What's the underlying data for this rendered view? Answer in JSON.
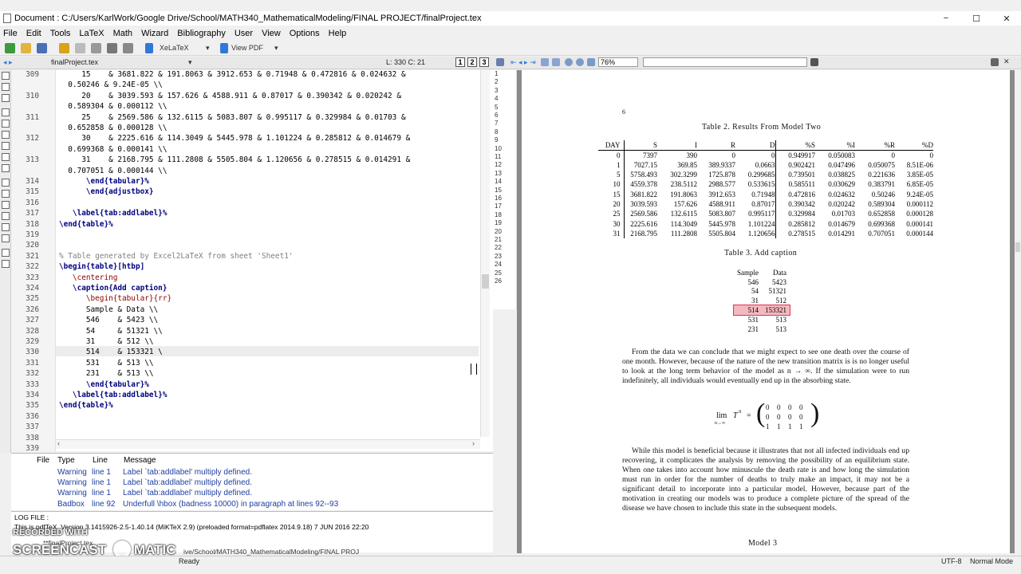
{
  "window": {
    "title": "Document : C:/Users/KarlWork/Google Drive/School/MATH340_MathematicalModeling/FINAL PROJECT/finalProject.tex",
    "minimize": "−",
    "maximize": "☐",
    "close": "✕"
  },
  "menu": [
    "File",
    "Edit",
    "Tools",
    "LaTeX",
    "Math",
    "Wizard",
    "Bibliography",
    "User",
    "View",
    "Options",
    "Help"
  ],
  "toolbar": {
    "compile": "XeLaTeX",
    "view": "View PDF"
  },
  "editor_tab": {
    "filename": "finalProject.tex",
    "position": "L: 330 C: 21",
    "views": [
      "1",
      "2",
      "3"
    ]
  },
  "code_lines": [
    {
      "n": "309",
      "t": "     15    & 3681.822 & 191.8063 & 3912.653 & 0.71948 & 0.472816 & 0.024632 &",
      "cls": ""
    },
    {
      "n": "",
      "t": "  0.50246 & 9.24E-05 \\\\",
      "cls": ""
    },
    {
      "n": "310",
      "t": "     20    & 3039.593 & 157.626 & 4588.911 & 0.87017 & 0.390342 & 0.020242 &",
      "cls": ""
    },
    {
      "n": "",
      "t": "  0.589304 & 0.000112 \\\\",
      "cls": ""
    },
    {
      "n": "311",
      "t": "     25    & 2569.586 & 132.6115 & 5083.807 & 0.995117 & 0.329984 & 0.01703 &",
      "cls": ""
    },
    {
      "n": "",
      "t": "  0.652858 & 0.000128 \\\\",
      "cls": ""
    },
    {
      "n": "312",
      "t": "     30    & 2225.616 & 114.3049 & 5445.978 & 1.101224 & 0.285812 & 0.014679 &",
      "cls": ""
    },
    {
      "n": "",
      "t": "  0.699368 & 0.000141 \\\\",
      "cls": ""
    },
    {
      "n": "313",
      "t": "     31    & 2168.795 & 111.2808 & 5505.804 & 1.120656 & 0.278515 & 0.014291 &",
      "cls": ""
    },
    {
      "n": "",
      "t": "  0.707051 & 0.000144 \\\\",
      "cls": ""
    },
    {
      "n": "314",
      "t": "      \\end{tabular}%",
      "cls": "kw"
    },
    {
      "n": "315",
      "t": "      \\end{adjustbox}",
      "cls": "kw"
    },
    {
      "n": "316",
      "t": "",
      "cls": ""
    },
    {
      "n": "317",
      "t": "   \\label{tab:addlabel}%",
      "cls": "kw"
    },
    {
      "n": "318",
      "t": "\\end{table}%",
      "cls": "kw"
    },
    {
      "n": "319",
      "t": "",
      "cls": ""
    },
    {
      "n": "320",
      "t": "",
      "cls": ""
    },
    {
      "n": "321",
      "t": "% Table generated by Excel2LaTeX from sheet 'Sheet1'",
      "cls": "cm"
    },
    {
      "n": "322",
      "t": "\\begin{table}[htbp]",
      "cls": "kw"
    },
    {
      "n": "323",
      "t": "   \\centering",
      "cls": "br"
    },
    {
      "n": "324",
      "t": "   \\caption{Add caption}",
      "cls": "kw"
    },
    {
      "n": "325",
      "t": "      \\begin{tabular}{rr}",
      "cls": "br"
    },
    {
      "n": "326",
      "t": "      Sample & Data \\\\",
      "cls": ""
    },
    {
      "n": "327",
      "t": "      546    & 5423 \\\\",
      "cls": ""
    },
    {
      "n": "328",
      "t": "      54     & 51321 \\\\",
      "cls": ""
    },
    {
      "n": "329",
      "t": "      31     & 512 \\\\",
      "cls": ""
    },
    {
      "n": "330",
      "t": "      514    & 153321 \\",
      "cls": ""
    },
    {
      "n": "331",
      "t": "      531    & 513 \\\\",
      "cls": ""
    },
    {
      "n": "332",
      "t": "      231    & 513 \\\\",
      "cls": ""
    },
    {
      "n": "333",
      "t": "      \\end{tabular}%",
      "cls": "kw"
    },
    {
      "n": "334",
      "t": "   \\label{tab:addlabel}%",
      "cls": "kw"
    },
    {
      "n": "335",
      "t": "\\end{table}%",
      "cls": "kw"
    },
    {
      "n": "336",
      "t": "",
      "cls": ""
    },
    {
      "n": "337",
      "t": "",
      "cls": ""
    },
    {
      "n": "338",
      "t": "",
      "cls": ""
    },
    {
      "n": "339",
      "t": "",
      "cls": ""
    }
  ],
  "messages": {
    "headers": [
      "File",
      "Type",
      "Line",
      "Message"
    ],
    "rows": [
      {
        "type": "Warning",
        "line": "line 1",
        "msg": "Label `tab:addlabel' multiply defined."
      },
      {
        "type": "Warning",
        "line": "line 1",
        "msg": "Label `tab:addlabel' multiply defined."
      },
      {
        "type": "Warning",
        "line": "line 1",
        "msg": "Label `tab:addlabel' multiply defined."
      },
      {
        "type": "Badbox",
        "line": "line 92",
        "msg": "Underfull \\hbox (badness 10000) in paragraph at lines 92--93"
      }
    ]
  },
  "log": {
    "title": "LOG FILE :",
    "line1": "This is pdfTeX, Version 3.1415926-2.5-1.40.14 (MiKTeX 2.9) (preloaded format=pdflatex 2014.9.18) 7 JUN 2016 22:20",
    "line2": "**finalProject.tex",
    "line3": "ive/School/MATH340_MathematicalModeling/FINAL PROJ"
  },
  "watermark": {
    "recorded": "RECORDED WITH",
    "brand": "SCREENCAST",
    "brand2": "MATIC"
  },
  "statusbar": {
    "ready": "Ready",
    "encoding": "UTF-8",
    "mode": "Normal Mode"
  },
  "pdf_toolbar": {
    "zoom": "76%"
  },
  "pdf_lines": [
    "1",
    "2",
    "3",
    "4",
    "5",
    "6",
    "7",
    "8",
    "9",
    "10",
    "11",
    "12",
    "13",
    "14",
    "15",
    "16",
    "17",
    "18",
    "19",
    "20",
    "21",
    "22",
    "23",
    "24",
    "25",
    "26"
  ],
  "pdf": {
    "page_num": "6",
    "table2_caption": "Table 2. Results From Model Two",
    "table2_headers": [
      "DAY",
      "S",
      "I",
      "R",
      "D",
      "%S",
      "%I",
      "%R",
      "%D"
    ],
    "table2_rows": [
      [
        "0",
        "7397",
        "390",
        "0",
        "0",
        "0.949917",
        "0.050083",
        "0",
        "0"
      ],
      [
        "1",
        "7027.15",
        "369.85",
        "389.9337",
        "0.0663",
        "0.902421",
        "0.047496",
        "0.050075",
        "8.51E-06"
      ],
      [
        "5",
        "5758.493",
        "302.3299",
        "1725.878",
        "0.299685",
        "0.739501",
        "0.038825",
        "0.221636",
        "3.85E-05"
      ],
      [
        "10",
        "4559.378",
        "238.5112",
        "2988.577",
        "0.533615",
        "0.585511",
        "0.030629",
        "0.383791",
        "6.85E-05"
      ],
      [
        "15",
        "3681.822",
        "191.8063",
        "3912.653",
        "0.71948",
        "0.472816",
        "0.024632",
        "0.50246",
        "9.24E-05"
      ],
      [
        "20",
        "3039.593",
        "157.626",
        "4588.911",
        "0.87017",
        "0.390342",
        "0.020242",
        "0.589304",
        "0.000112"
      ],
      [
        "25",
        "2569.586",
        "132.6115",
        "5083.807",
        "0.995117",
        "0.329984",
        "0.01703",
        "0.652858",
        "0.000128"
      ],
      [
        "30",
        "2225.616",
        "114.3049",
        "5445.978",
        "1.101224",
        "0.285812",
        "0.014679",
        "0.699368",
        "0.000141"
      ],
      [
        "31",
        "2168.795",
        "111.2808",
        "5505.804",
        "1.120656",
        "0.278515",
        "0.014291",
        "0.707051",
        "0.000144"
      ]
    ],
    "table3_caption": "Table 3. Add caption",
    "table3_headers": [
      "Sample",
      "Data"
    ],
    "table3_rows": [
      [
        "546",
        "5423"
      ],
      [
        "54",
        "51321"
      ],
      [
        "31",
        "512"
      ],
      [
        "514",
        "153321"
      ],
      [
        "531",
        "513"
      ],
      [
        "231",
        "513"
      ]
    ],
    "para1": "From the data we can conclude that we might expect to see one death over the course of one month. However, because of the nature of the new transition matrix is is no longer useful to look at the long term behavior of the model as n → ∞. If the simulation were to run indefinitely, all individuals would eventually end up in the absorbing state.",
    "eq_lhs": "lim",
    "eq_sub": "n→∞",
    "eq_T": "T",
    "eq_n": "n",
    "eq_eq": "=",
    "matrix": [
      [
        "0",
        "0",
        "0",
        "0"
      ],
      [
        "0",
        "0",
        "0",
        "0"
      ],
      [
        "1",
        "1",
        "1",
        "1"
      ]
    ],
    "para2": "While this model is beneficial because it illustrates that not all infected individuals end up recovering, it complicates the analysis by removing the possibility of an equilibrium state. When one takes into account how minuscule the death rate is and how long the simulation must run in order for the number of deaths to truly make an impact, it may not be a significant detail to incorporate into a particular model. However, because part of the motivation in creating our models was to produce a complete picture of the spread of the disease we have chosen to include this state in the subsequent models.",
    "model3": "Model 3"
  }
}
